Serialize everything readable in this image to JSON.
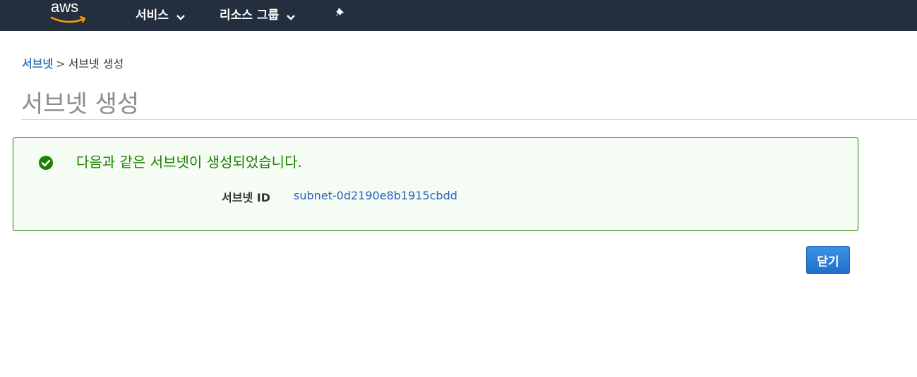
{
  "topbar": {
    "logo_text": "aws",
    "brand_color": "#232f3e",
    "accent_color": "#ff9900",
    "nav": [
      {
        "label": "서비스",
        "icon": "chevron-down-icon"
      },
      {
        "label": "리소스 그룹",
        "icon": "chevron-down-icon"
      }
    ],
    "pin_icon": "pushpin-icon"
  },
  "breadcrumb": {
    "link": "서브넷",
    "separator": ">",
    "current": "서브넷 생성"
  },
  "page": {
    "title": "서브넷 생성"
  },
  "alert": {
    "status": "success",
    "icon": "check-circle-icon",
    "color": "#1d8102",
    "message": "다음과 같은 서브넷이 생성되었습니다.",
    "field_label": "서브넷 ID",
    "field_value": "subnet-0d2190e8b1915cbdd"
  },
  "actions": {
    "close_label": "닫기"
  }
}
